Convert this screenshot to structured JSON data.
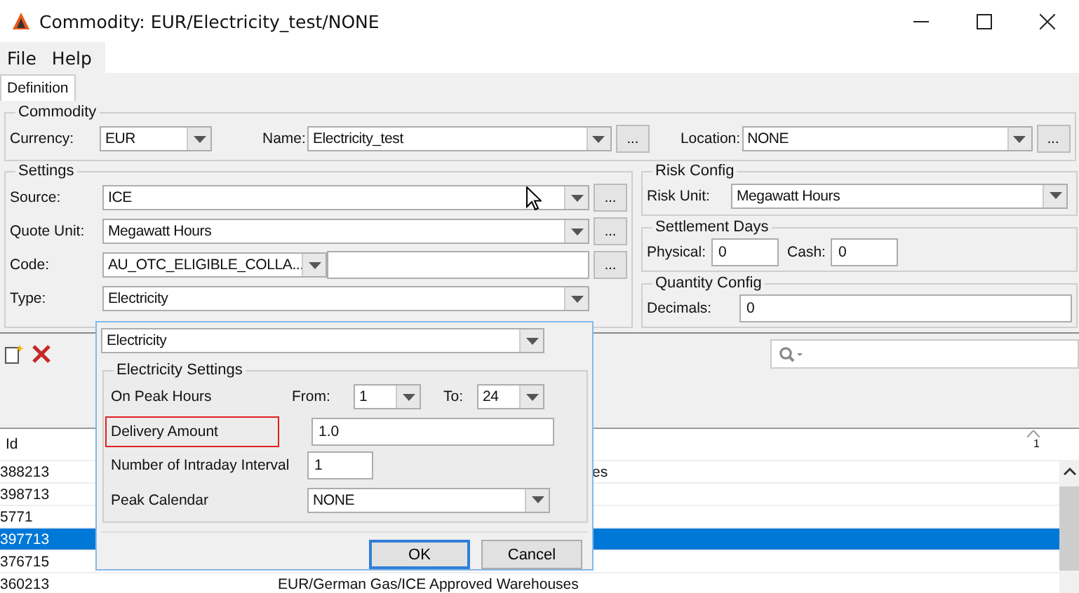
{
  "window": {
    "title": "Commodity: EUR/Electricity_test/NONE"
  },
  "menu": [
    "File",
    "Help"
  ],
  "tabs": [
    {
      "label": "Definition",
      "selected": true
    }
  ],
  "commodity": {
    "title": "Commodity",
    "fields": [
      {
        "label": "Currency:",
        "value": "EUR",
        "kind": "combo"
      },
      {
        "label": "Name:",
        "value": "Electricity_test",
        "kind": "combo",
        "button": "..."
      },
      {
        "label": "Location:",
        "value": "NONE",
        "kind": "combo",
        "button": "..."
      }
    ]
  },
  "settings": {
    "title": "Settings",
    "fields": [
      {
        "label": "Source:",
        "value": "ICE",
        "kind": "combo",
        "button": "..."
      },
      {
        "label": "Quote Unit:",
        "value": "Megawatt Hours",
        "kind": "combo",
        "button": "..."
      },
      {
        "label": "Code:",
        "value": "AU_OTC_ELIGIBLE_COLLA...",
        "kind": "code",
        "button": "..."
      },
      {
        "label": "Type:",
        "value": "Electricity",
        "kind": "combo"
      }
    ]
  },
  "risk_config": {
    "title": "Risk Config",
    "label": "Risk Unit:",
    "value": "Megawatt Hours"
  },
  "settlement_days": {
    "title": "Settlement Days",
    "fields": [
      {
        "label": "Physical:",
        "value": "0"
      },
      {
        "label": "Cash:",
        "value": "0"
      }
    ]
  },
  "quantity_config": {
    "title": "Quantity Config",
    "label": "Decimals:",
    "value": "0"
  },
  "table": {
    "columns": [
      "Id"
    ],
    "sort_indicator": "1",
    "rows": [
      {
        "id": "388213",
        "column_2": "es",
        "kind": "tail",
        "selected": false
      },
      {
        "id": "398713",
        "selected": false
      },
      {
        "id": "5771",
        "selected": false
      },
      {
        "id": "397713",
        "selected": true
      },
      {
        "id": "376715",
        "selected": false
      },
      {
        "id": "360213",
        "column_2": "EUR/German Gas/ICE Approved Warehouses",
        "kind": "full",
        "selected": false
      }
    ]
  },
  "dialog": {
    "type_value": "Electricity",
    "group_title": "Electricity Settings",
    "peak_hours": {
      "label": "On Peak Hours",
      "from_label": "From:",
      "from_value": "1",
      "to_label": "To:",
      "to_value": "24"
    },
    "delivery_amount": {
      "label": "Delivery Amount",
      "value": "1.0",
      "highlighted": true
    },
    "intraday": {
      "label": "Number of Intraday Interval",
      "value": "1"
    },
    "peak_calendar": {
      "label": "Peak Calendar",
      "value": "NONE"
    },
    "buttons": [
      {
        "label": "OK",
        "default": true
      },
      {
        "label": "Cancel",
        "default": false
      }
    ]
  }
}
